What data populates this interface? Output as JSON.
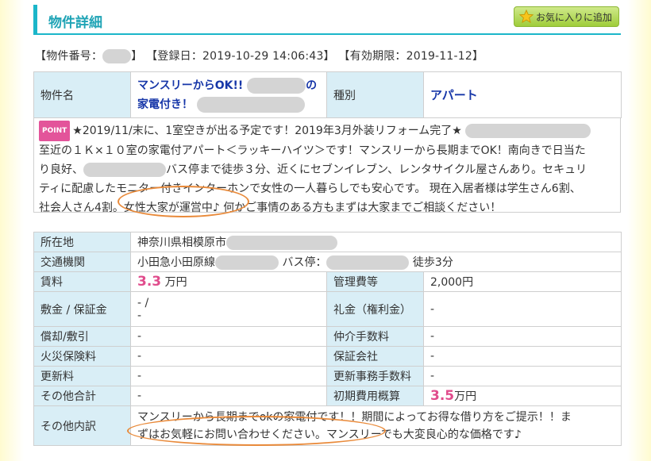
{
  "header": {
    "title": "物件詳細",
    "fav_button": "お気に入りに追加",
    "fav_icon": "star-icon"
  },
  "meta": {
    "number_label": "【物件番号：",
    "number_close": "】",
    "registered": "【登録日：2019-10-29 14:06:43】",
    "expires": "【有効期限：2019-11-12】"
  },
  "property": {
    "name_label": "物件名",
    "name_line1": "マンスリーからOK!!",
    "name_line1_suffix": "の",
    "name_line2": "家電付き！",
    "type_label": "種別",
    "type_value": "アパート"
  },
  "description": {
    "badge": "POINT",
    "line1": "★2019/11/末に、1室空きが出る予定です！2019年3月外装リフォーム完了★",
    "line2": "至近の１Ｋ×１０室の家電付アパート＜ラッキーハイツ＞です！マンスリーから長期までOK！南向きで日当た",
    "line3a": "り良好、",
    "line3b": "バス停まで徒歩３分、近くにセブンイレブン、レンタサイクル屋さんあり。セキュリ",
    "line4": "ティに配慮したモニター付きインターホンで女性の一人暮らしでも安心です。 現在入居者様は学生さん6割、",
    "line5": "社会人さん4割。女性大家が運営中♪ 何かご事情のある方もまずは大家までご相談ください！"
  },
  "details": {
    "location_label": "所在地",
    "location_value": "神奈川県相模原市",
    "transport_label": "交通機関",
    "transport_line": "小田急小田原線",
    "transport_bus": "バス停：",
    "transport_walk": "徒歩3分",
    "rent_label": "賃料",
    "rent_value": "3.3",
    "rent_unit": "万円",
    "mgmt_label": "管理費等",
    "mgmt_value": "2,000円",
    "deposit_label": "敷金 / 保証金",
    "deposit_value1": "- /",
    "deposit_value2": "-",
    "keymoney_label": "礼金（権利金）",
    "keymoney_value": "-",
    "amort_label": "償却/敷引",
    "amort_value": "-",
    "broker_label": "仲介手数料",
    "broker_value": "-",
    "fire_label": "火災保険料",
    "fire_value": "-",
    "guarantor_label": "保証会社",
    "guarantor_value": "-",
    "renew_label": "更新料",
    "renew_value": "-",
    "renew_fee_label": "更新事務手数料",
    "renew_fee_value": "-",
    "other_total_label": "その他合計",
    "other_total_value": "-",
    "initial_label": "初期費用概算",
    "initial_value": "3.5",
    "initial_unit": "万円",
    "other_detail_label": "その他内訳",
    "other_detail_line1": "マンスリーから長期までokの家電付です！！期間によってお得な借り方をご提示！！ま",
    "other_detail_line2": "ずはお気軽にお問い合わせください。マンスリーでも大変良心的な価格です♪"
  }
}
